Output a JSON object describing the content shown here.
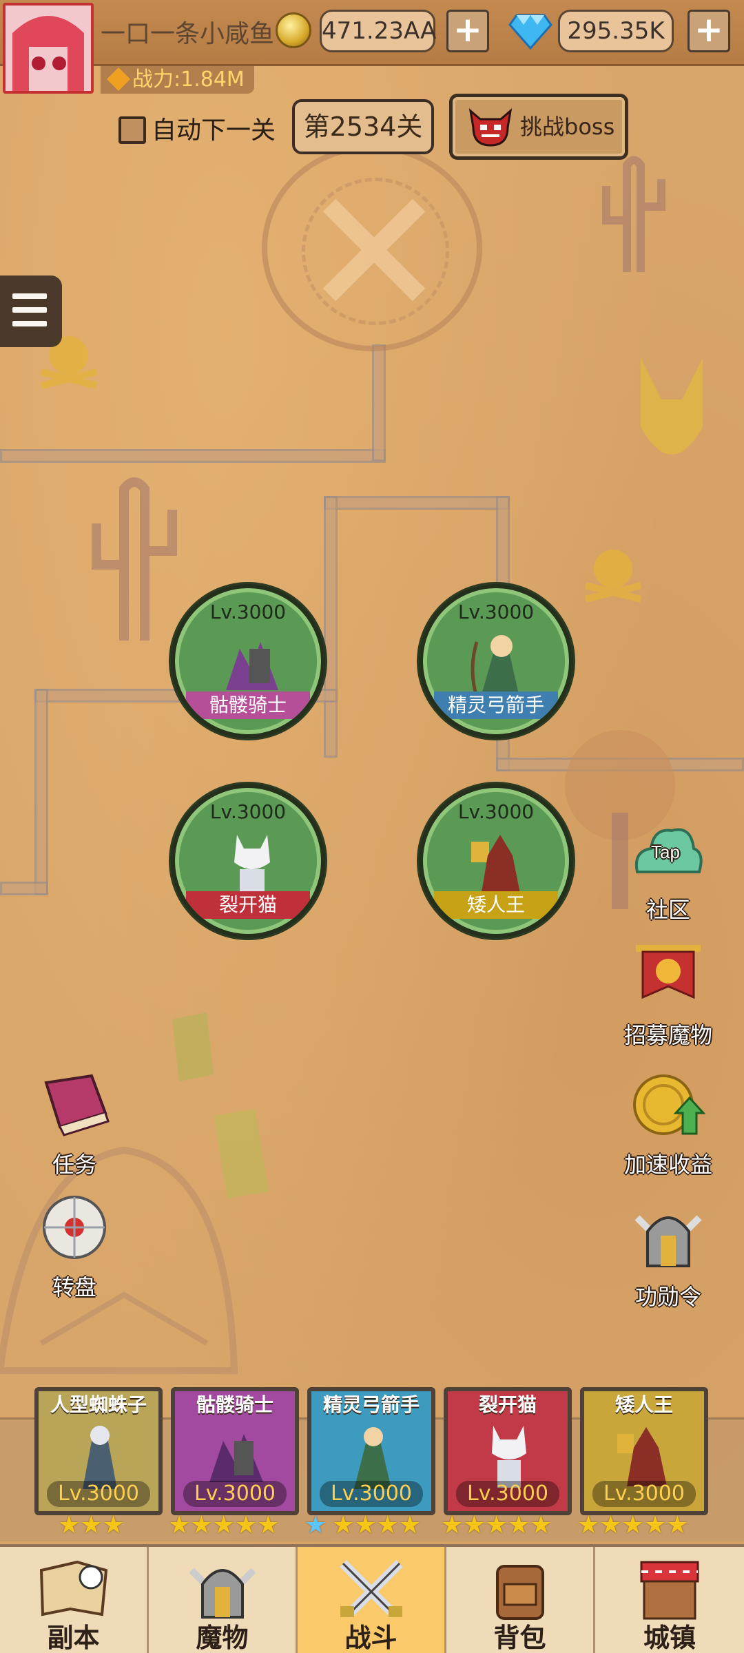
{
  "header": {
    "player_name": "一口一条小咸鱼",
    "gold_amount": "471.23AA",
    "gem_amount": "295.35K",
    "plus_label": "+",
    "power_label": "战力:1.84M"
  },
  "controls": {
    "auto_next_label": "自动下一关",
    "stage_label": "第2534关",
    "boss_label": "挑战boss"
  },
  "map_heroes": [
    {
      "level": "Lv.3000",
      "name": "骷髅骑士",
      "ribbon_color": "#b54f98"
    },
    {
      "level": "Lv.3000",
      "name": "精灵弓箭手",
      "ribbon_color": "#3f7fb0"
    },
    {
      "level": "Lv.3000",
      "name": "裂开猫",
      "ribbon_color": "#c0303a"
    },
    {
      "level": "Lv.3000",
      "name": "矮人王",
      "ribbon_color": "#c7a216"
    }
  ],
  "side_right": {
    "community": "社区",
    "community_badge": "Tap",
    "recruit": "招募魔物",
    "speed": "加速收益",
    "merit": "功勋令"
  },
  "side_left": {
    "tasks": "任务",
    "wheel": "转盘"
  },
  "team": [
    {
      "name": "人型蜘蛛子",
      "level": "Lv.3000",
      "bg": "#b8a558"
    },
    {
      "name": "骷髅骑士",
      "level": "Lv.3000",
      "bg": "#a24aa0"
    },
    {
      "name": "精灵弓箭手",
      "level": "Lv.3000",
      "bg": "#3d9bc0"
    },
    {
      "name": "裂开猫",
      "level": "Lv.3000",
      "bg": "#c23a48"
    },
    {
      "name": "矮人王",
      "level": "Lv.3000",
      "bg": "#c9a63a"
    }
  ],
  "stars": {
    "group1": "★★★",
    "group2": "★★★★★",
    "group3_blue": "★",
    "group3": "★★★★",
    "group4": "★★★★★",
    "group5": "★★★★★"
  },
  "nav": [
    {
      "label": "副本",
      "icon": "map-scroll-icon"
    },
    {
      "label": "魔物",
      "icon": "monster-helmet-icon"
    },
    {
      "label": "战斗",
      "icon": "crossed-swords-icon"
    },
    {
      "label": "背包",
      "icon": "backpack-icon"
    },
    {
      "label": "城镇",
      "icon": "shop-icon"
    }
  ],
  "colors": {
    "active_nav": "#f9c96a",
    "hero_circle": "#5a9a55"
  }
}
